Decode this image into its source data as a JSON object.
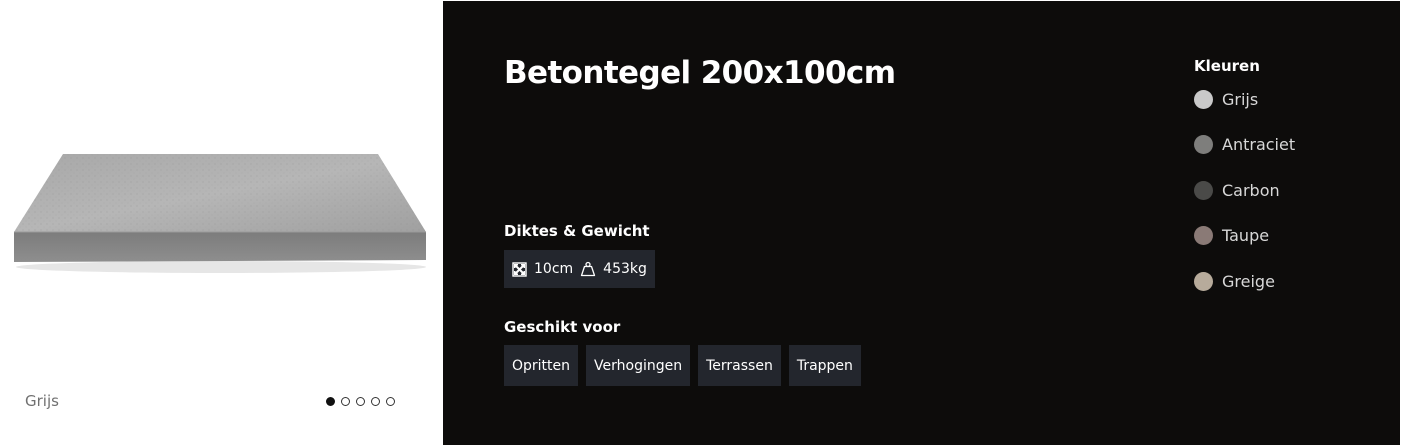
{
  "gallery": {
    "caption": "Grijs",
    "dots": [
      true,
      false,
      false,
      false,
      false
    ]
  },
  "product": {
    "title": "Betontegel 200x100cm"
  },
  "specs": {
    "label": "Diktes & Gewicht",
    "thickness": "10cm",
    "weight": "453kg",
    "thickness_icon": "dimensions-icon",
    "weight_icon": "weight-icon"
  },
  "usage": {
    "label": "Geschikt voor",
    "tags": [
      "Opritten",
      "Verhogingen",
      "Terrassen",
      "Trappen"
    ]
  },
  "colors": {
    "label": "Kleuren",
    "items": [
      {
        "name": "Grijs",
        "hex": "#c9c9c9"
      },
      {
        "name": "Antraciet",
        "hex": "#7e7e7c"
      },
      {
        "name": "Carbon",
        "hex": "#4a4a48"
      },
      {
        "name": "Taupe",
        "hex": "#8a7a76"
      },
      {
        "name": "Greige",
        "hex": "#b7ab9b"
      }
    ]
  }
}
